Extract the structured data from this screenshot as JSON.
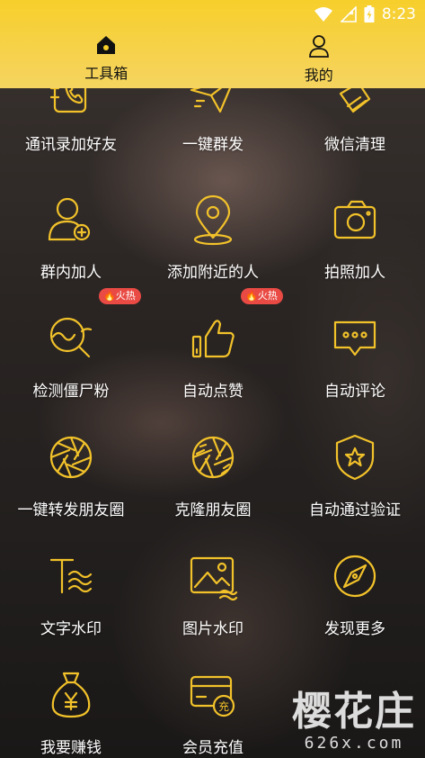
{
  "status_bar": {
    "time": "8:23"
  },
  "tabs": [
    {
      "label": "工具箱",
      "icon": "home-icon",
      "active": true
    },
    {
      "label": "我的",
      "icon": "user-icon",
      "active": false
    }
  ],
  "tools": [
    {
      "label": "通讯录加好友",
      "icon": "contacts-book-icon"
    },
    {
      "label": "一键群发",
      "icon": "send-plane-icon"
    },
    {
      "label": "微信清理",
      "icon": "broom-icon"
    },
    {
      "label": "群内加人",
      "icon": "add-person-icon"
    },
    {
      "label": "添加附近的人",
      "icon": "location-pin-icon"
    },
    {
      "label": "拍照加人",
      "icon": "camera-icon"
    },
    {
      "label": "检测僵尸粉",
      "icon": "magnifier-wave-icon",
      "badge": "火热"
    },
    {
      "label": "自动点赞",
      "icon": "thumbs-up-icon",
      "badge": "火热"
    },
    {
      "label": "自动评论",
      "icon": "chat-bubble-icon"
    },
    {
      "label": "一键转发朋友圈",
      "icon": "aperture-icon"
    },
    {
      "label": "克隆朋友圈",
      "icon": "aperture-stripes-icon"
    },
    {
      "label": "自动通过验证",
      "icon": "shield-star-icon"
    },
    {
      "label": "文字水印",
      "icon": "text-wave-icon"
    },
    {
      "label": "图片水印",
      "icon": "image-wave-icon"
    },
    {
      "label": "发现更多",
      "icon": "compass-icon"
    },
    {
      "label": "我要赚钱",
      "icon": "money-bag-icon"
    },
    {
      "label": "会员充值",
      "icon": "card-recharge-icon"
    }
  ],
  "watermark": {
    "title": "樱花庄",
    "subtitle": "626x.com"
  },
  "colors": {
    "header": "#f7cf2b",
    "accent_icon": "#f2c22a",
    "badge": "#e94a43"
  }
}
